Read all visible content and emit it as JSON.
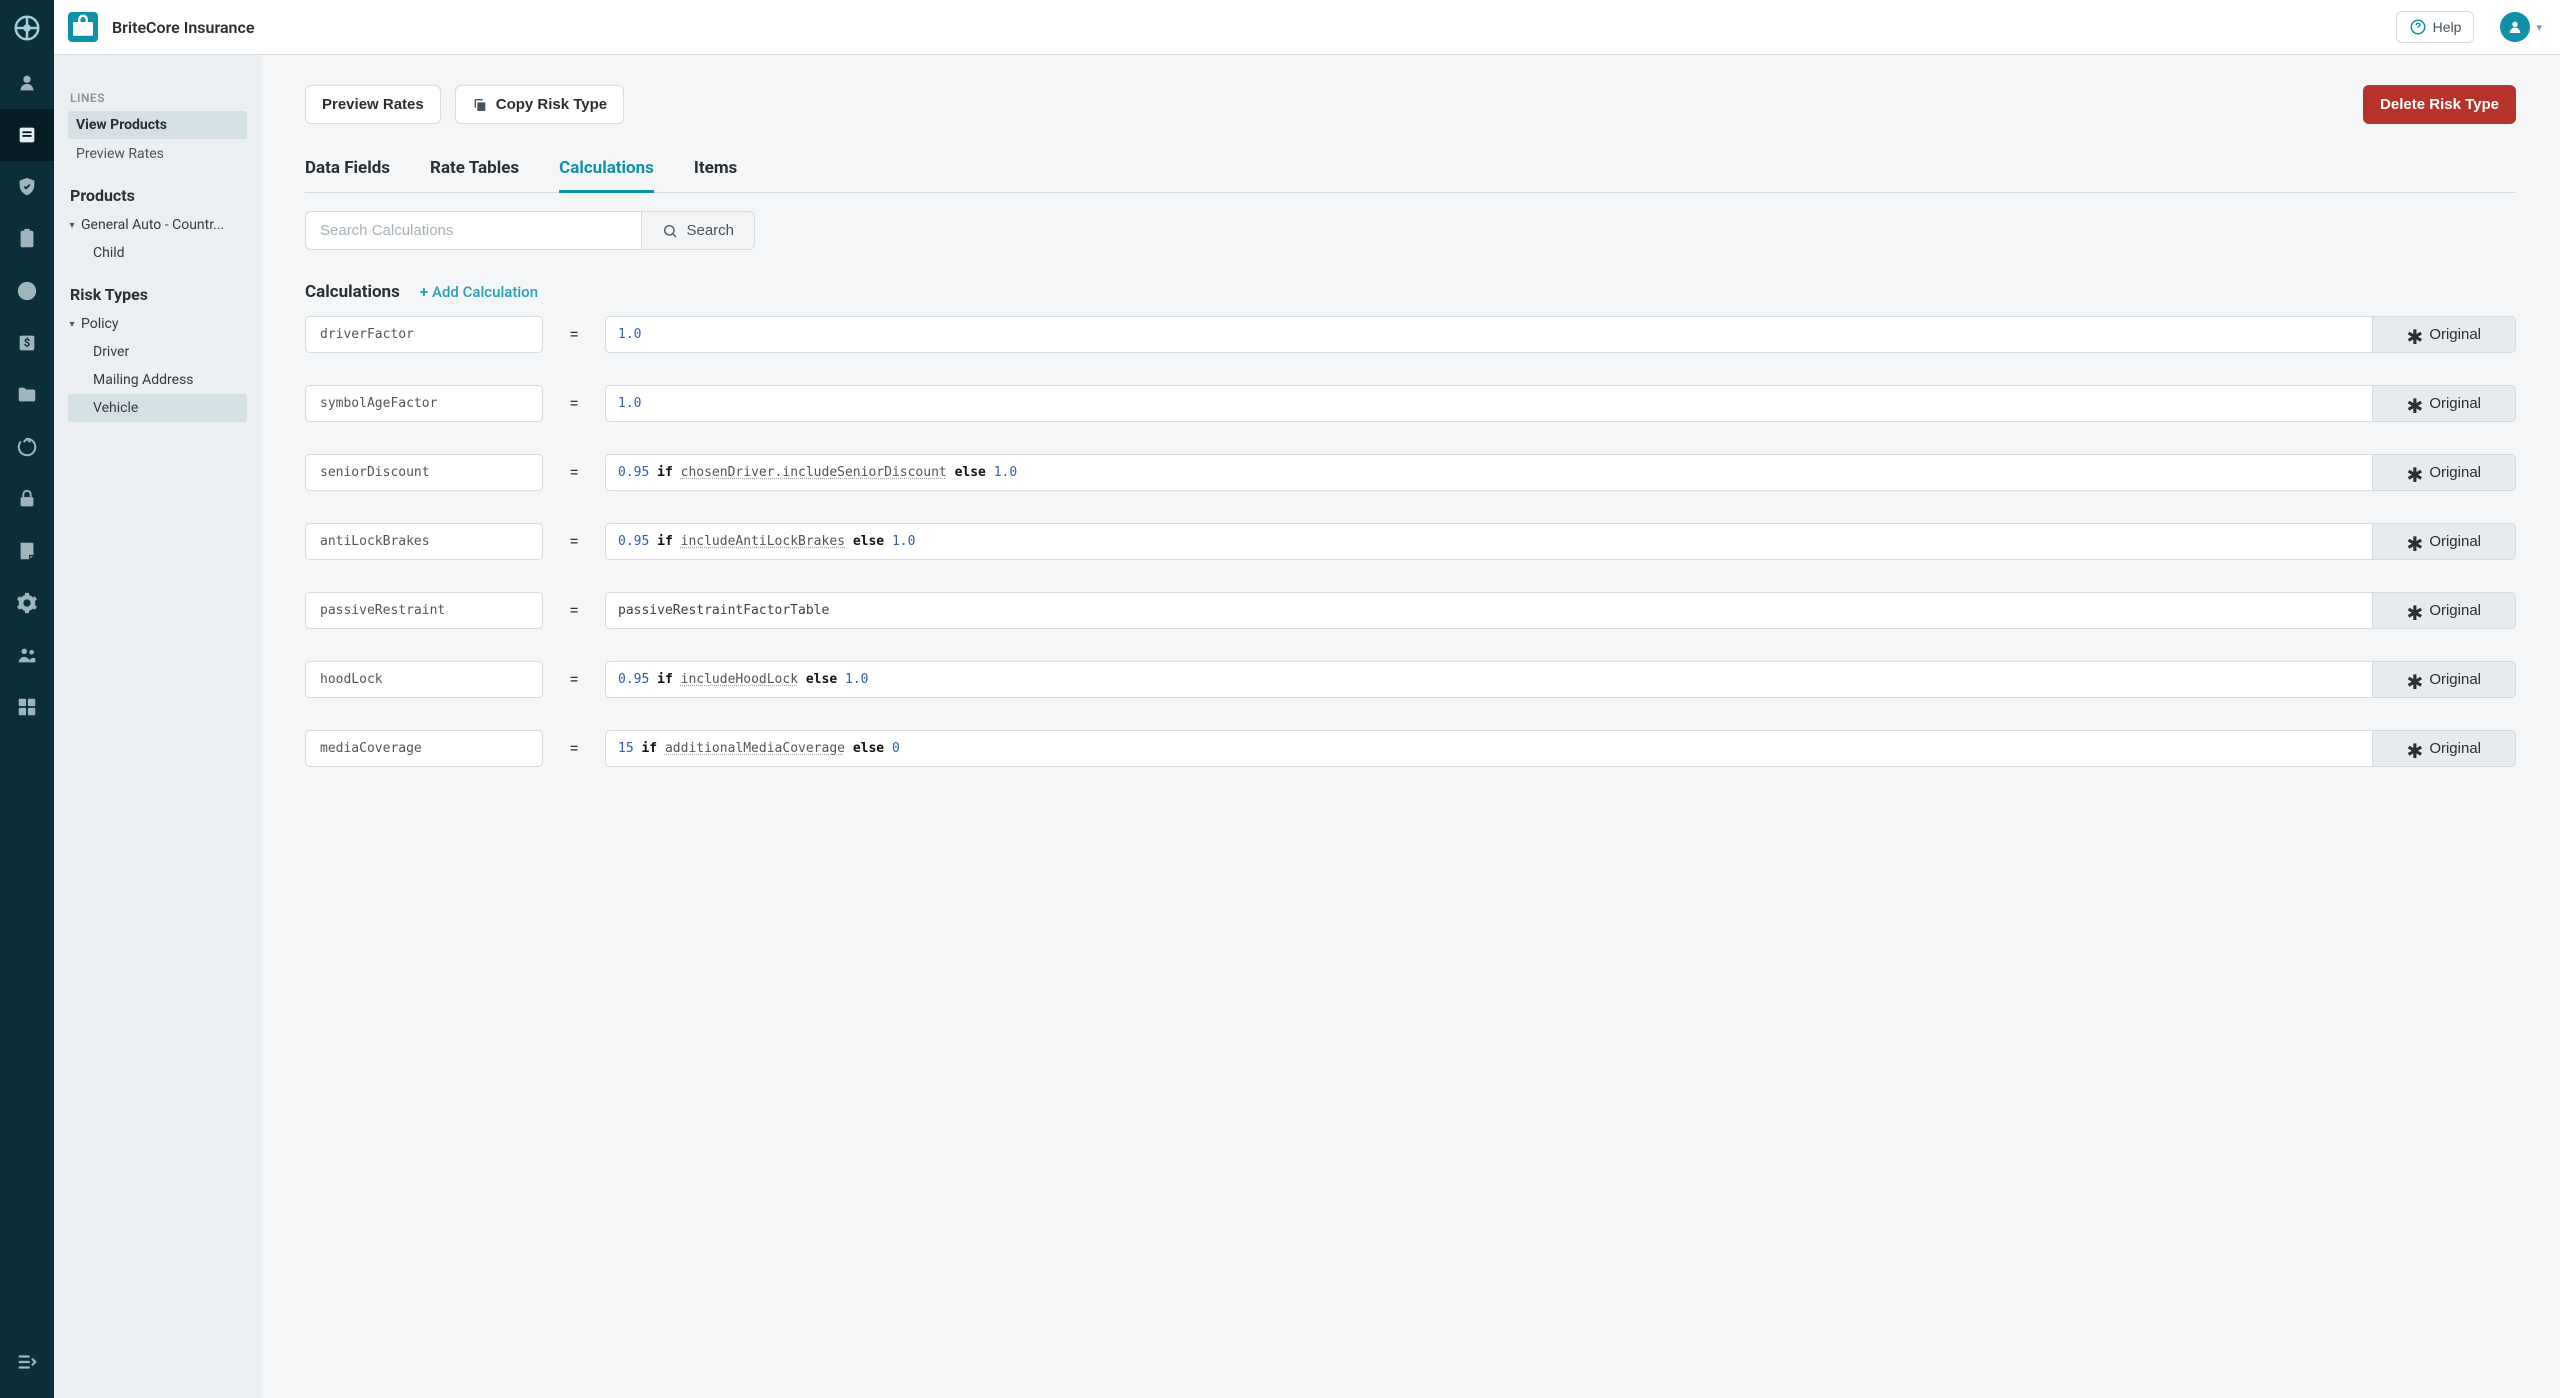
{
  "app_title": "BriteCore Insurance",
  "help_label": "Help",
  "sidebar": {
    "lines_heading": "LINES",
    "view_products": "View Products",
    "preview_rates": "Preview Rates",
    "products_heading": "Products",
    "product_line": "General Auto - Countr...",
    "product_child": "Child",
    "risk_types_heading": "Risk Types",
    "policy": "Policy",
    "driver": "Driver",
    "mailing_address": "Mailing Address",
    "vehicle": "Vehicle"
  },
  "actions": {
    "preview_rates": "Preview Rates",
    "copy_risk_type": "Copy Risk Type",
    "delete_risk_type": "Delete Risk Type"
  },
  "tabs": {
    "data_fields": "Data Fields",
    "rate_tables": "Rate Tables",
    "calculations": "Calculations",
    "items": "Items"
  },
  "search": {
    "placeholder": "Search Calculations",
    "button": "Search"
  },
  "section": {
    "title": "Calculations",
    "add": "Add Calculation"
  },
  "original_label": "Original",
  "calculations": [
    {
      "name": "driverFactor",
      "tokens": [
        {
          "t": "num",
          "v": "1.0"
        }
      ]
    },
    {
      "name": "symbolAgeFactor",
      "tokens": [
        {
          "t": "num",
          "v": "1.0"
        }
      ]
    },
    {
      "name": "seniorDiscount",
      "tokens": [
        {
          "t": "num",
          "v": "0.95"
        },
        {
          "t": "sp"
        },
        {
          "t": "kw",
          "v": "if"
        },
        {
          "t": "sp"
        },
        {
          "t": "var",
          "v": "chosenDriver.includeSeniorDiscount"
        },
        {
          "t": "sp"
        },
        {
          "t": "kw",
          "v": "else"
        },
        {
          "t": "sp"
        },
        {
          "t": "num",
          "v": "1.0"
        }
      ]
    },
    {
      "name": "antiLockBrakes",
      "tokens": [
        {
          "t": "num",
          "v": "0.95"
        },
        {
          "t": "sp"
        },
        {
          "t": "kw",
          "v": "if"
        },
        {
          "t": "sp"
        },
        {
          "t": "var",
          "v": "includeAntiLockBrakes"
        },
        {
          "t": "sp"
        },
        {
          "t": "kw",
          "v": "else"
        },
        {
          "t": "sp"
        },
        {
          "t": "num",
          "v": "1.0"
        }
      ]
    },
    {
      "name": "passiveRestraint",
      "tokens": [
        {
          "t": "plain",
          "v": "passiveRestraintFactorTable"
        }
      ]
    },
    {
      "name": "hoodLock",
      "tokens": [
        {
          "t": "num",
          "v": "0.95"
        },
        {
          "t": "sp"
        },
        {
          "t": "kw",
          "v": "if"
        },
        {
          "t": "sp"
        },
        {
          "t": "var",
          "v": "includeHoodLock"
        },
        {
          "t": "sp"
        },
        {
          "t": "kw",
          "v": "else"
        },
        {
          "t": "sp"
        },
        {
          "t": "num",
          "v": "1.0"
        }
      ]
    },
    {
      "name": "mediaCoverage",
      "tokens": [
        {
          "t": "num",
          "v": "15"
        },
        {
          "t": "sp"
        },
        {
          "t": "kw",
          "v": "if"
        },
        {
          "t": "sp"
        },
        {
          "t": "var",
          "v": "additionalMediaCoverage"
        },
        {
          "t": "sp"
        },
        {
          "t": "kw",
          "v": "else"
        },
        {
          "t": "sp"
        },
        {
          "t": "num",
          "v": "0"
        }
      ]
    }
  ]
}
